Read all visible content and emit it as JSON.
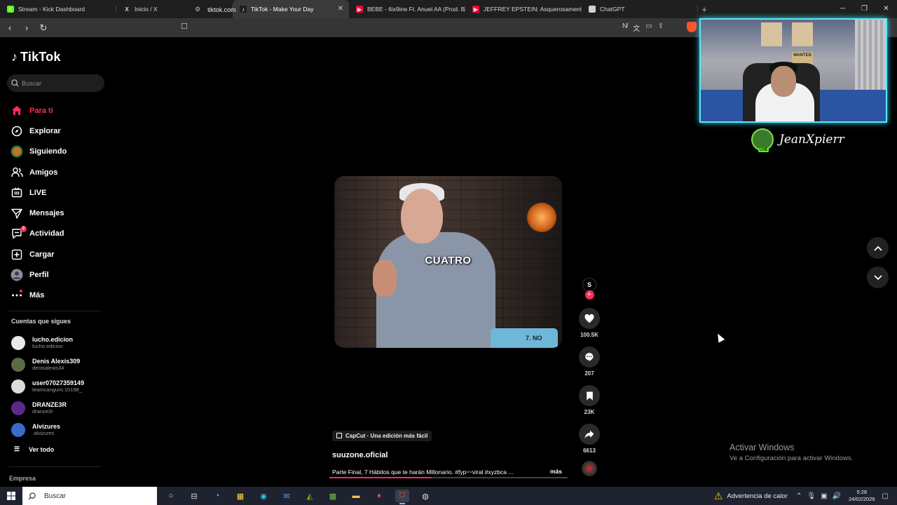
{
  "browser": {
    "tabs": [
      {
        "title": "Stream - Kick Dashboard",
        "fav_color": "#53fc18",
        "fav_glyph": "K"
      },
      {
        "title": "Inicio / X",
        "fav_color": "#1f1f1f",
        "fav_glyph": "X"
      },
      {
        "title": "TikTok - Make Your Day",
        "fav_color": "#1f1f1f",
        "fav_glyph": "♪",
        "active": true
      },
      {
        "title": "BEBE - 6ix9ine Ft. Anuel AA (Prod. By",
        "fav_color": "#ff0033",
        "fav_glyph": "▶"
      },
      {
        "title": "JEFFREY EPSTEIN: Asquerosamente R",
        "fav_color": "#ff0033",
        "fav_glyph": "▶"
      },
      {
        "title": "ChatGPT",
        "fav_color": "#cfcfcf",
        "fav_glyph": "◎"
      }
    ],
    "new_tab": "+",
    "url": "tiktok.com"
  },
  "sidebar": {
    "brand": "TikTok",
    "search_placeholder": "Buscar",
    "menu": [
      {
        "label": "Para ti",
        "icon": "home-icon",
        "active": true
      },
      {
        "label": "Explorar",
        "icon": "compass-icon"
      },
      {
        "label": "Siguiendo",
        "icon": "following-avatar-icon"
      },
      {
        "label": "Amigos",
        "icon": "friends-icon"
      },
      {
        "label": "LIVE",
        "icon": "live-icon"
      },
      {
        "label": "Mensajes",
        "icon": "messages-icon"
      },
      {
        "label": "Actividad",
        "icon": "activity-icon",
        "badge": "2"
      },
      {
        "label": "Cargar",
        "icon": "upload-icon"
      },
      {
        "label": "Perfil",
        "icon": "profile-icon"
      },
      {
        "label": "Más",
        "icon": "more-icon"
      }
    ],
    "following_title": "Cuentas que sigues",
    "following": [
      {
        "name": "lucho.edicion",
        "handle": "lucho.edicion",
        "color": "#e8e8e8"
      },
      {
        "name": "Denis Alexis309",
        "handle": "denisalexis34",
        "color": "#5a6b48"
      },
      {
        "name": "user07027359149",
        "handle": "teamcanguro.10198_",
        "color": "#dcdcdc"
      },
      {
        "name": "DRANZE3R",
        "handle": "dranze3r",
        "color": "#5b2a8c"
      },
      {
        "name": "Alvizures",
        "handle": ".alvizures",
        "color": "#3a6bc9"
      }
    ],
    "see_all": "Ver todo",
    "company": "Empresa"
  },
  "video": {
    "caption_overlay": "CUATRO",
    "corner_text": "7. NO",
    "capcut_label": "CapCut · Una edición más fácil",
    "author": "suuzone.oficial",
    "description": "Parte Final, 7 Hábitos que te harán Millonario. #fyp〰viral #xyzbca ...",
    "more": "más",
    "progress_pct": 43
  },
  "actions": {
    "avatar_letter": "S",
    "likes": "100.5K",
    "comments": "207",
    "saves": "23K",
    "shares": "6613"
  },
  "overlay": {
    "streamer_name": "JeanXpierr",
    "live_badge": "LIVE",
    "poster_text": "WANTED"
  },
  "watermark": {
    "line1": "Activar Windows",
    "line2": "Ve a Configuración para activar Windows."
  },
  "taskbar": {
    "search_placeholder": "Buscar",
    "heat_warning": "Advertencia de calor",
    "time": "5:28",
    "date": "24/02/2026"
  }
}
